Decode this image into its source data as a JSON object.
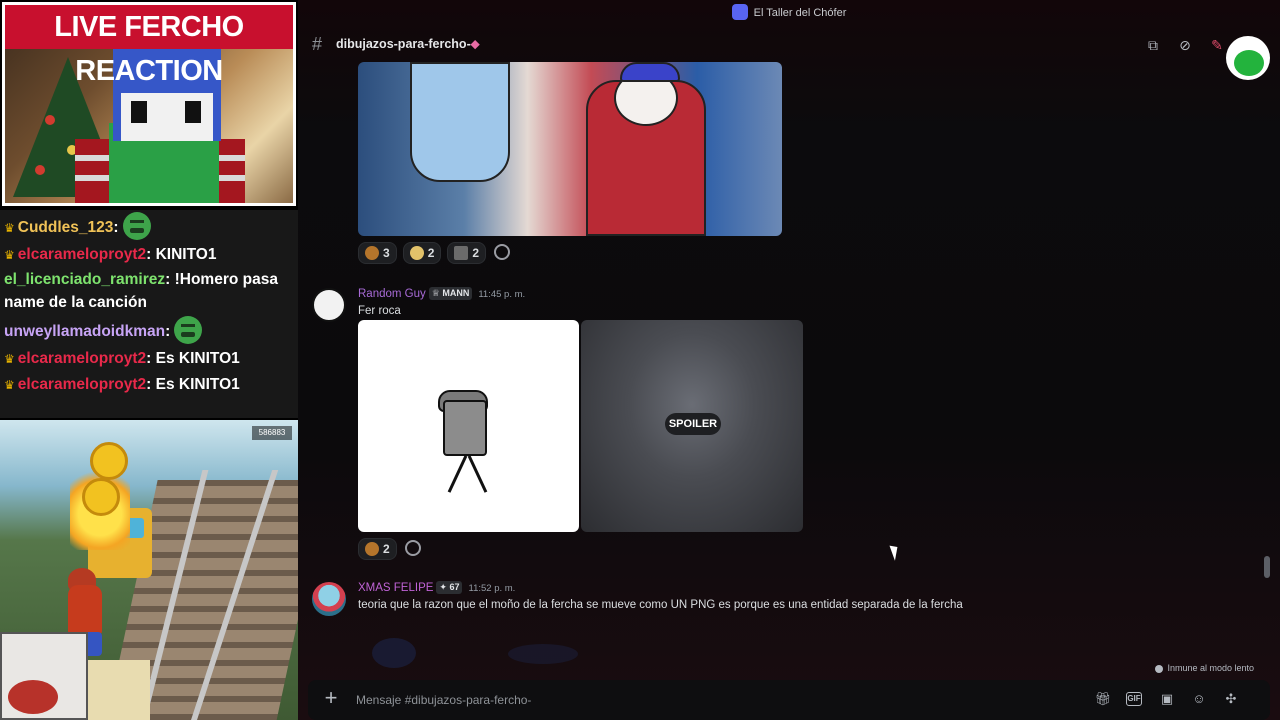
{
  "stream": {
    "title": "LIVE FERCHO REACTION",
    "game_score": "586883",
    "chat": [
      {
        "user": "Cuddles_123",
        "color": "#f0c257",
        "crown": true,
        "text": "",
        "emote": "green-emote"
      },
      {
        "user": "elcarameloproyt2",
        "color": "#e8294a",
        "crown": true,
        "text": "KINITO1"
      },
      {
        "user": "el_licenciado_ramirez",
        "color": "#7ee36e",
        "crown": false,
        "text": "!Homero pasa name de la canción"
      },
      {
        "user": "unweyllamadoidkman",
        "color": "#c7a4f5",
        "crown": false,
        "text": "",
        "emote": "green-emote"
      },
      {
        "user": "elcarameloproyt2",
        "color": "#e8294a",
        "crown": true,
        "text": "Es KINITO1"
      },
      {
        "user": "elcarameloproyt2",
        "color": "#e8294a",
        "crown": true,
        "text": "Es KINITO1"
      }
    ]
  },
  "discord": {
    "server_name": "El Taller del Chófer",
    "channel": {
      "name": "dibujazos-para-fercho-",
      "icon": "pill-icon"
    },
    "header_icons": [
      "threads-icon",
      "mute-icon",
      "pin-icon"
    ],
    "top_image_reactions": [
      {
        "icon": "emoji-reaction-icon",
        "count": "3"
      },
      {
        "icon": "emoji-reaction-icon",
        "count": "2"
      },
      {
        "icon": "emoji-reaction-icon",
        "count": "2"
      }
    ],
    "messages": [
      {
        "author": "Random Guy",
        "author_color": "#a86ad6",
        "tag": "MANN",
        "time": "11:45 p. m.",
        "text": "Fer roca",
        "spoiler_label": "SPOILER",
        "reactions": [
          {
            "icon": "emoji-reaction-icon",
            "count": "2"
          }
        ]
      },
      {
        "author": "XMAS FELIPE",
        "author_color": "#c063d6",
        "tag": "67",
        "time": "11:52 p. m.",
        "text": "teoria que la razon que el moño de la fercha se mueve como UN PNG es porque es una entidad separada de la fercha"
      }
    ],
    "slowmode_text": "Inmune al modo lento",
    "composer": {
      "placeholder": "Mensaje #dibujazos-para-fercho-",
      "icons": [
        "gift-icon",
        "gif-icon",
        "sticker-icon",
        "emoji-icon",
        "apps-icon"
      ]
    }
  }
}
